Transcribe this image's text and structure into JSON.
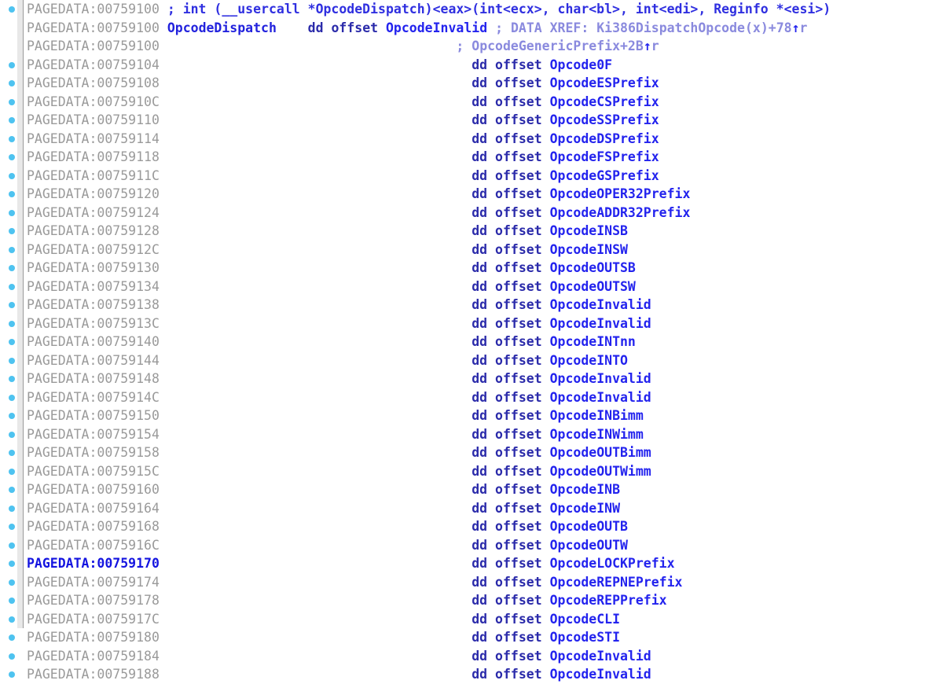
{
  "app": {
    "name": "IDA Pro disassembly view",
    "segment": "PAGEDATA",
    "view_type": "IDA View-A"
  },
  "colors": {
    "background": "#ffffff",
    "address_text": "#9a9a9a",
    "address_highlight": "#1414e0",
    "symbol": "#2323ee",
    "keyword": "#2b2baa",
    "comment": "#2f2fe0",
    "xref_text": "#8a8ade",
    "marker_dot": "#4ec3f0",
    "gutter_bar": "#e8e8e8"
  },
  "gutter": {
    "marker_name": "breakpoint-marker-dot"
  },
  "columns": {
    "address_label": "PAGEDATA",
    "directive": "dd",
    "operator": "offset"
  },
  "rows": [
    {
      "dot": true,
      "highlight": false,
      "address": "PAGEDATA:00759100",
      "kind": "comment",
      "comment": "; int (__usercall *OpcodeDispatch)<eax>(int<ecx>, char<bl>, int<edi>, Reginfo *<esi>)"
    },
    {
      "dot": false,
      "highlight": false,
      "address": "PAGEDATA:00759100",
      "kind": "labeled_data",
      "label": "OpcodeDispatch",
      "directive": "dd offset",
      "symbol": "OpcodeInvalid",
      "xref": "; DATA XREF: Ki386DispatchOpcode(x)+78",
      "xref_arrow": "↑",
      "xref_suffix": "r"
    },
    {
      "dot": false,
      "highlight": false,
      "address": "PAGEDATA:00759100",
      "kind": "xref_continuation",
      "xref": "; OpcodeGenericPrefix+2B",
      "xref_arrow": "↑",
      "xref_suffix": "r"
    },
    {
      "dot": true,
      "highlight": false,
      "address": "PAGEDATA:00759104",
      "kind": "data",
      "directive": "dd offset",
      "symbol": "Opcode0F"
    },
    {
      "dot": true,
      "highlight": false,
      "address": "PAGEDATA:00759108",
      "kind": "data",
      "directive": "dd offset",
      "symbol": "OpcodeESPrefix"
    },
    {
      "dot": true,
      "highlight": false,
      "address": "PAGEDATA:0075910C",
      "kind": "data",
      "directive": "dd offset",
      "symbol": "OpcodeCSPrefix"
    },
    {
      "dot": true,
      "highlight": false,
      "address": "PAGEDATA:00759110",
      "kind": "data",
      "directive": "dd offset",
      "symbol": "OpcodeSSPrefix"
    },
    {
      "dot": true,
      "highlight": false,
      "address": "PAGEDATA:00759114",
      "kind": "data",
      "directive": "dd offset",
      "symbol": "OpcodeDSPrefix"
    },
    {
      "dot": true,
      "highlight": false,
      "address": "PAGEDATA:00759118",
      "kind": "data",
      "directive": "dd offset",
      "symbol": "OpcodeFSPrefix"
    },
    {
      "dot": true,
      "highlight": false,
      "address": "PAGEDATA:0075911C",
      "kind": "data",
      "directive": "dd offset",
      "symbol": "OpcodeGSPrefix"
    },
    {
      "dot": true,
      "highlight": false,
      "address": "PAGEDATA:00759120",
      "kind": "data",
      "directive": "dd offset",
      "symbol": "OpcodeOPER32Prefix"
    },
    {
      "dot": true,
      "highlight": false,
      "address": "PAGEDATA:00759124",
      "kind": "data",
      "directive": "dd offset",
      "symbol": "OpcodeADDR32Prefix"
    },
    {
      "dot": true,
      "highlight": false,
      "address": "PAGEDATA:00759128",
      "kind": "data",
      "directive": "dd offset",
      "symbol": "OpcodeINSB"
    },
    {
      "dot": true,
      "highlight": false,
      "address": "PAGEDATA:0075912C",
      "kind": "data",
      "directive": "dd offset",
      "symbol": "OpcodeINSW"
    },
    {
      "dot": true,
      "highlight": false,
      "address": "PAGEDATA:00759130",
      "kind": "data",
      "directive": "dd offset",
      "symbol": "OpcodeOUTSB"
    },
    {
      "dot": true,
      "highlight": false,
      "address": "PAGEDATA:00759134",
      "kind": "data",
      "directive": "dd offset",
      "symbol": "OpcodeOUTSW"
    },
    {
      "dot": true,
      "highlight": false,
      "address": "PAGEDATA:00759138",
      "kind": "data",
      "directive": "dd offset",
      "symbol": "OpcodeInvalid"
    },
    {
      "dot": true,
      "highlight": false,
      "address": "PAGEDATA:0075913C",
      "kind": "data",
      "directive": "dd offset",
      "symbol": "OpcodeInvalid"
    },
    {
      "dot": true,
      "highlight": false,
      "address": "PAGEDATA:00759140",
      "kind": "data",
      "directive": "dd offset",
      "symbol": "OpcodeINTnn"
    },
    {
      "dot": true,
      "highlight": false,
      "address": "PAGEDATA:00759144",
      "kind": "data",
      "directive": "dd offset",
      "symbol": "OpcodeINTO"
    },
    {
      "dot": true,
      "highlight": false,
      "address": "PAGEDATA:00759148",
      "kind": "data",
      "directive": "dd offset",
      "symbol": "OpcodeInvalid"
    },
    {
      "dot": true,
      "highlight": false,
      "address": "PAGEDATA:0075914C",
      "kind": "data",
      "directive": "dd offset",
      "symbol": "OpcodeInvalid"
    },
    {
      "dot": true,
      "highlight": false,
      "address": "PAGEDATA:00759150",
      "kind": "data",
      "directive": "dd offset",
      "symbol": "OpcodeINBimm"
    },
    {
      "dot": true,
      "highlight": false,
      "address": "PAGEDATA:00759154",
      "kind": "data",
      "directive": "dd offset",
      "symbol": "OpcodeINWimm"
    },
    {
      "dot": true,
      "highlight": false,
      "address": "PAGEDATA:00759158",
      "kind": "data",
      "directive": "dd offset",
      "symbol": "OpcodeOUTBimm"
    },
    {
      "dot": true,
      "highlight": false,
      "address": "PAGEDATA:0075915C",
      "kind": "data",
      "directive": "dd offset",
      "symbol": "OpcodeOUTWimm"
    },
    {
      "dot": true,
      "highlight": false,
      "address": "PAGEDATA:00759160",
      "kind": "data",
      "directive": "dd offset",
      "symbol": "OpcodeINB"
    },
    {
      "dot": true,
      "highlight": false,
      "address": "PAGEDATA:00759164",
      "kind": "data",
      "directive": "dd offset",
      "symbol": "OpcodeINW"
    },
    {
      "dot": true,
      "highlight": false,
      "address": "PAGEDATA:00759168",
      "kind": "data",
      "directive": "dd offset",
      "symbol": "OpcodeOUTB"
    },
    {
      "dot": true,
      "highlight": false,
      "address": "PAGEDATA:0075916C",
      "kind": "data",
      "directive": "dd offset",
      "symbol": "OpcodeOUTW"
    },
    {
      "dot": true,
      "highlight": true,
      "address": "PAGEDATA:00759170",
      "kind": "data",
      "directive": "dd offset",
      "symbol": "OpcodeLOCKPrefix"
    },
    {
      "dot": true,
      "highlight": false,
      "address": "PAGEDATA:00759174",
      "kind": "data",
      "directive": "dd offset",
      "symbol": "OpcodeREPNEPrefix"
    },
    {
      "dot": true,
      "highlight": false,
      "address": "PAGEDATA:00759178",
      "kind": "data",
      "directive": "dd offset",
      "symbol": "OpcodeREPPrefix"
    },
    {
      "dot": true,
      "highlight": false,
      "address": "PAGEDATA:0075917C",
      "kind": "data",
      "directive": "dd offset",
      "symbol": "OpcodeCLI"
    },
    {
      "dot": true,
      "highlight": false,
      "address": "PAGEDATA:00759180",
      "kind": "data",
      "directive": "dd offset",
      "symbol": "OpcodeSTI"
    },
    {
      "dot": true,
      "highlight": false,
      "address": "PAGEDATA:00759184",
      "kind": "data",
      "directive": "dd offset",
      "symbol": "OpcodeInvalid"
    },
    {
      "dot": true,
      "highlight": false,
      "address": "PAGEDATA:00759188",
      "kind": "data",
      "directive": "dd offset",
      "symbol": "OpcodeInvalid"
    }
  ]
}
